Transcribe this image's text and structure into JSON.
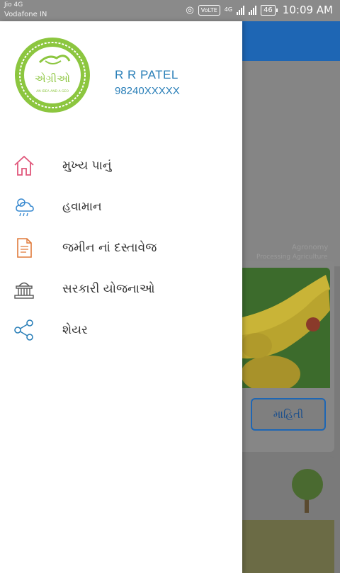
{
  "status_bar": {
    "carrier_line1": "Jio 4G",
    "carrier_line2": "Vodafone IN",
    "volte_badge": "VoLTE",
    "network": "4G",
    "battery": "46",
    "time": "10:09 AM"
  },
  "drawer": {
    "logo_text": "એગ્રીઓ",
    "logo_subtext": "AN IDEA AND A GEO",
    "user_name": "R R PATEL",
    "user_phone": "98240XXXXX",
    "items": [
      {
        "label": "મુખ્ય પાનું",
        "icon": "home-icon"
      },
      {
        "label": "હવામાન",
        "icon": "weather-icon"
      },
      {
        "label": "જમીન નાં દસ્તાવેજ",
        "icon": "document-icon"
      },
      {
        "label": "સરકારી યોજનાઓ",
        "icon": "government-building-icon"
      },
      {
        "label": "શેયર",
        "icon": "share-icon"
      }
    ]
  },
  "background_app": {
    "card1_text_a": "Agronomy",
    "card1_text_b": "Processing Agriculture",
    "info_button": "માહિતી"
  },
  "colors": {
    "accent": "#2a7fb8",
    "logo_green": "#8cc63f",
    "icon_pink": "#e0567a",
    "app_bar": "#1e66b4"
  }
}
